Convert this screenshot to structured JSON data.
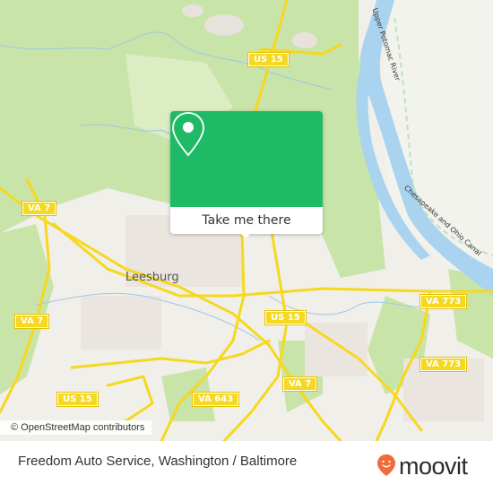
{
  "map": {
    "town_label": "Leesburg",
    "road_shields": [
      {
        "id": "us15-north",
        "label": "US 15"
      },
      {
        "id": "va7-west",
        "label": "VA 7"
      },
      {
        "id": "va7-southwest",
        "label": "VA 7"
      },
      {
        "id": "us15-center",
        "label": "US 15"
      },
      {
        "id": "va773-east",
        "label": "VA 773"
      },
      {
        "id": "va773-southeast",
        "label": "VA 773"
      },
      {
        "id": "va7-center",
        "label": "VA 7"
      },
      {
        "id": "us15-southwest",
        "label": "US 15"
      },
      {
        "id": "va643",
        "label": "VA 643"
      }
    ],
    "water_labels": {
      "river": "Upper Potomac River",
      "canal": "Chesapeake and Ohio Canal"
    },
    "attribution": "© OpenStreetMap contributors",
    "colors": {
      "land": "#f1efe9",
      "forest": "#c9e4a8",
      "water": "#a9d3ee",
      "road": "#f5d81f",
      "popup_accent": "#1fba66"
    }
  },
  "popup": {
    "icon": "location-pin-icon",
    "button_label": "Take me there"
  },
  "footer": {
    "title": "Freedom Auto Service, Washington / Baltimore",
    "brand": "moovit",
    "brand_color": "#f26a36"
  }
}
